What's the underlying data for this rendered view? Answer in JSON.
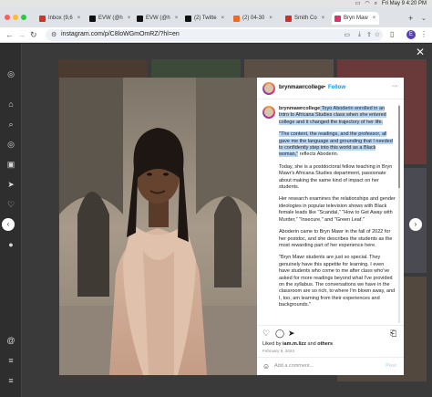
{
  "menubar": {
    "datetime": "Fri May 9  4:20 PM"
  },
  "colors": {
    "tab_strip": "#dfe3e8",
    "accent_blue": "#0095f6",
    "highlight": "#b9d6f5"
  },
  "tabs": [
    {
      "label": "Inbox (9,6",
      "icon": "gmail-icon",
      "color": "#d93025"
    },
    {
      "label": "EVW (@h",
      "icon": "twitter-x-icon",
      "color": "#111111"
    },
    {
      "label": "EVW (@h",
      "icon": "twitter-x-icon",
      "color": "#111111"
    },
    {
      "label": "(2) Twitte",
      "icon": "twitter-x-icon",
      "color": "#111111"
    },
    {
      "label": "(2) 04-30",
      "icon": "orange-app-icon",
      "color": "#f26a21"
    },
    {
      "label": "Smith Co",
      "icon": "smith-icon",
      "color": "#d62b2b"
    },
    {
      "label": "Bryn Maw",
      "icon": "instagram-icon",
      "color": "#e1306c"
    }
  ],
  "address_bar": {
    "url": "instagram.com/p/C8loWGmOmRZ/?hl=en",
    "profile_initial": "E"
  },
  "post": {
    "username": "brynmawrcollege",
    "separator": "•",
    "follow_label": "Follow",
    "more_label": "···",
    "caption_user": "brynmawrcollege",
    "paragraphs": [
      {
        "text": " Toyo Aboderin enrolled in an Intro to Africana Studies class when she entered college and it changed the trajectory of her life.",
        "highlighted": true,
        "with_user": true
      },
      {
        "text": "\"The content, the readings, and the professor, all gave me the language and grounding that I needed to confidently step into this world as a Black woman,\"",
        "highlighted": true,
        "tail": " reflects Aboderin."
      },
      {
        "text": "Today, she is a postdoctoral fellow teaching in Bryn Mawr's Africana Studies department, passionate about making the same kind of impact on her students."
      },
      {
        "text": "Her research examines the relationships and gender ideologies in popular television shows with Black female leads like \"Scandal,\" \"How to Get Away with Murder,\" \"Insecure,\" and \"Green Leaf.\""
      },
      {
        "text": "Aboderin came to Bryn Mawr in the fall of 2022 for her postdoc, and she describes the students as the most rewarding part of her experience here."
      },
      {
        "text": "\"Bryn Mawr students are just so special. They genuinely have this appetite for learning. I even have students who come to me after class who've asked for more readings beyond what I've provided on the syllabus. The conversations we have in the classroom are so rich, to where I'm blown away, and I, too, am learning from their experiences and backgrounds.\""
      }
    ],
    "liked_prefix": "Liked by ",
    "liked_user": "iam.m.lizz",
    "liked_suffix": " and ",
    "liked_others": "others",
    "date": "February 9, 2024",
    "comment_placeholder": "Add a comment...",
    "post_label": "Post"
  }
}
